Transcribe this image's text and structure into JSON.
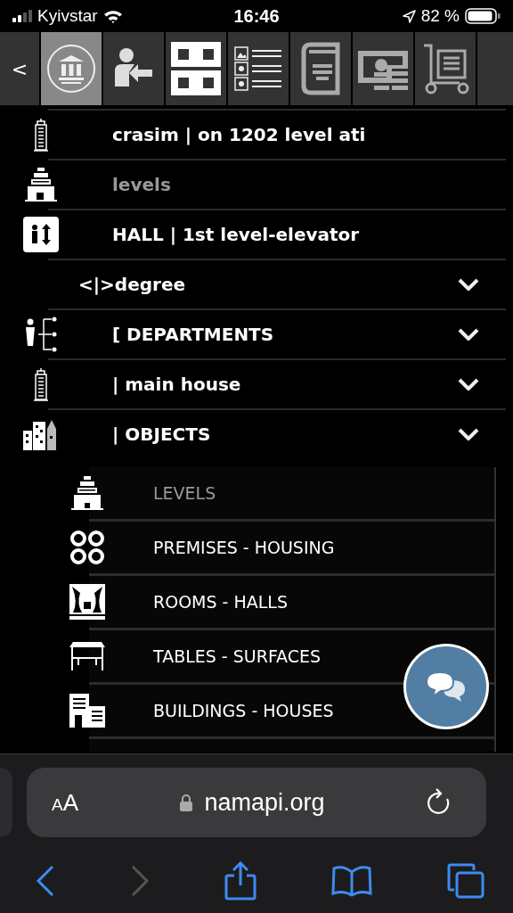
{
  "status_bar": {
    "carrier": "Kyivstar",
    "time": "16:46",
    "battery": "82 %"
  },
  "toolbar": {
    "back": "<",
    "tools": [
      {
        "selected": true
      },
      {
        "selected": false
      },
      {
        "selected": false
      },
      {
        "selected": false
      },
      {
        "selected": false
      },
      {
        "selected": false
      },
      {
        "selected": false
      }
    ]
  },
  "menu": [
    {
      "label": "crasim | on 1202 level ati",
      "dimmed": false,
      "expandable": false
    },
    {
      "label": "levels",
      "dimmed": true,
      "expandable": false
    },
    {
      "label": "HALL | 1st level-elevator",
      "dimmed": false,
      "expandable": false
    },
    {
      "label": "<|>degree",
      "dimmed": false,
      "expandable": true
    },
    {
      "label": "[ DEPARTMENTS",
      "dimmed": false,
      "expandable": true
    },
    {
      "label": "| main house",
      "dimmed": false,
      "expandable": true
    },
    {
      "label": "| OBJECTS",
      "dimmed": false,
      "expandable": true
    }
  ],
  "submenu": [
    {
      "label": "LEVELS",
      "dimmed": true
    },
    {
      "label": "PREMISES - HOUSING",
      "dimmed": false
    },
    {
      "label": "ROOMS - HALLS",
      "dimmed": false
    },
    {
      "label": "TABLES - SURFACES",
      "dimmed": false
    },
    {
      "label": "BUILDINGS - HOUSES",
      "dimmed": false
    }
  ],
  "browser": {
    "text_size": "AA",
    "url": "namapi.org",
    "nav": [
      {
        "disabled": false
      },
      {
        "disabled": true
      },
      {
        "disabled": false
      },
      {
        "disabled": false
      },
      {
        "disabled": false
      }
    ]
  }
}
